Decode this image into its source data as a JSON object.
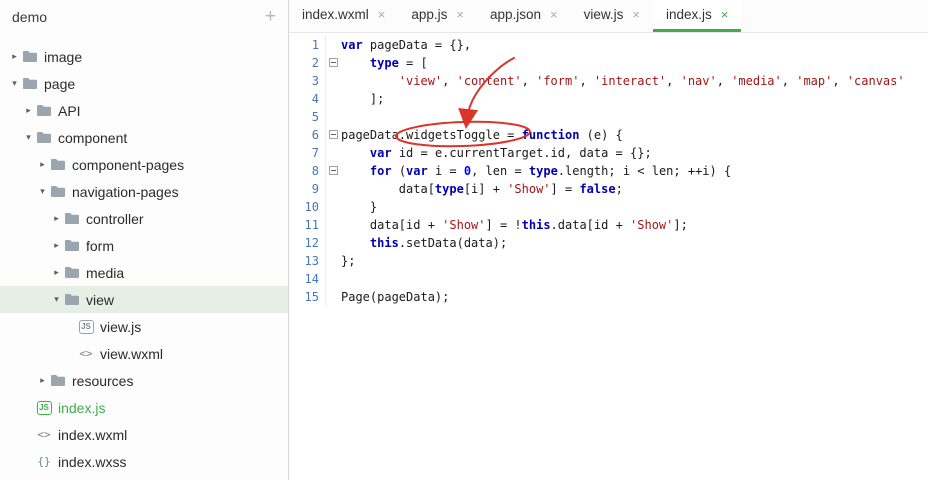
{
  "colors": {
    "accent_green": "#3fae4a",
    "tree_selection_bg": "#e5efe6",
    "annotation_red": "#d9352a",
    "syntax_keyword": "#0000b2",
    "syntax_string": "#a31515",
    "syntax_number": "#0000ff",
    "syntax_plain": "#1a1a1a",
    "line_number": "#4777b8"
  },
  "sidebar": {
    "title": "demo",
    "add_button": "+",
    "file_icons": {
      "js": "JS",
      "wxml": "<>",
      "wxss": "{}"
    },
    "tree": [
      {
        "label": "image",
        "depth": 0,
        "kind": "folder",
        "state": "collapsed"
      },
      {
        "label": "page",
        "depth": 0,
        "kind": "folder",
        "state": "expanded"
      },
      {
        "label": "API",
        "depth": 1,
        "kind": "folder",
        "state": "collapsed"
      },
      {
        "label": "component",
        "depth": 1,
        "kind": "folder",
        "state": "expanded"
      },
      {
        "label": "component-pages",
        "depth": 2,
        "kind": "folder",
        "state": "collapsed"
      },
      {
        "label": "navigation-pages",
        "depth": 2,
        "kind": "folder",
        "state": "expanded"
      },
      {
        "label": "controller",
        "depth": 3,
        "kind": "folder",
        "state": "collapsed"
      },
      {
        "label": "form",
        "depth": 3,
        "kind": "folder",
        "state": "collapsed"
      },
      {
        "label": "media",
        "depth": 3,
        "kind": "folder",
        "state": "collapsed"
      },
      {
        "label": "view",
        "depth": 3,
        "kind": "folder",
        "state": "expanded",
        "selected": true
      },
      {
        "label": "view.js",
        "depth": 4,
        "kind": "file",
        "icon": "js"
      },
      {
        "label": "view.wxml",
        "depth": 4,
        "kind": "file",
        "icon": "wxml"
      },
      {
        "label": "resources",
        "depth": 2,
        "kind": "folder",
        "state": "collapsed"
      },
      {
        "label": "index.js",
        "depth": 1,
        "kind": "file",
        "icon": "js",
        "highlight": true
      },
      {
        "label": "index.wxml",
        "depth": 1,
        "kind": "file",
        "icon": "wxml"
      },
      {
        "label": "index.wxss",
        "depth": 1,
        "kind": "file",
        "icon": "wxss"
      }
    ]
  },
  "tabs": [
    {
      "label": "index.wxml",
      "close": "×"
    },
    {
      "label": "app.js",
      "close": "×"
    },
    {
      "label": "app.json",
      "close": "×"
    },
    {
      "label": "view.js",
      "close": "×"
    },
    {
      "label": "index.js",
      "close": "×",
      "active": true
    }
  ],
  "editor": {
    "lines": [
      {
        "n": "1",
        "fold": false,
        "seg": [
          [
            "kw",
            "var"
          ],
          [
            "pl",
            " pageData = {},"
          ]
        ]
      },
      {
        "n": "2",
        "fold": true,
        "seg": [
          [
            "pl",
            "    "
          ],
          [
            "kw",
            "type"
          ],
          [
            "pl",
            " = ["
          ]
        ]
      },
      {
        "n": "3",
        "fold": false,
        "seg": [
          [
            "pl",
            "        "
          ],
          [
            "str",
            "'view'"
          ],
          [
            "pl",
            ", "
          ],
          [
            "str",
            "'content'"
          ],
          [
            "pl",
            ", "
          ],
          [
            "str",
            "'form'"
          ],
          [
            "pl",
            ", "
          ],
          [
            "str",
            "'interact'"
          ],
          [
            "pl",
            ", "
          ],
          [
            "str",
            "'nav'"
          ],
          [
            "pl",
            ", "
          ],
          [
            "str",
            "'media'"
          ],
          [
            "pl",
            ", "
          ],
          [
            "str",
            "'map'"
          ],
          [
            "pl",
            ", "
          ],
          [
            "str",
            "'canvas'"
          ]
        ]
      },
      {
        "n": "4",
        "fold": false,
        "seg": [
          [
            "pl",
            "    ];"
          ]
        ]
      },
      {
        "n": "5",
        "fold": false,
        "seg": []
      },
      {
        "n": "6",
        "fold": true,
        "seg": [
          [
            "pl",
            "pageData.widgetsToggle = "
          ],
          [
            "kw",
            "function"
          ],
          [
            "pl",
            " (e) {"
          ]
        ]
      },
      {
        "n": "7",
        "fold": false,
        "seg": [
          [
            "pl",
            "    "
          ],
          [
            "kw",
            "var"
          ],
          [
            "pl",
            " id = e.currentTarget.id, data = {};"
          ]
        ]
      },
      {
        "n": "8",
        "fold": true,
        "seg": [
          [
            "pl",
            "    "
          ],
          [
            "kw",
            "for"
          ],
          [
            "pl",
            " ("
          ],
          [
            "kw",
            "var"
          ],
          [
            "pl",
            " i = "
          ],
          [
            "num",
            "0"
          ],
          [
            "pl",
            ", len = "
          ],
          [
            "kw",
            "type"
          ],
          [
            "pl",
            ".length; i < len; ++i) {"
          ]
        ]
      },
      {
        "n": "9",
        "fold": false,
        "seg": [
          [
            "pl",
            "        data["
          ],
          [
            "kw",
            "type"
          ],
          [
            "pl",
            "[i] + "
          ],
          [
            "str",
            "'Show'"
          ],
          [
            "pl",
            "] = "
          ],
          [
            "kw",
            "false"
          ],
          [
            "pl",
            ";"
          ]
        ]
      },
      {
        "n": "10",
        "fold": false,
        "seg": [
          [
            "pl",
            "    }"
          ]
        ]
      },
      {
        "n": "11",
        "fold": false,
        "seg": [
          [
            "pl",
            "    data[id + "
          ],
          [
            "str",
            "'Show'"
          ],
          [
            "pl",
            "] = !"
          ],
          [
            "kw",
            "this"
          ],
          [
            "pl",
            ".data[id + "
          ],
          [
            "str",
            "'Show'"
          ],
          [
            "pl",
            "];"
          ]
        ]
      },
      {
        "n": "12",
        "fold": false,
        "seg": [
          [
            "pl",
            "    "
          ],
          [
            "kw",
            "this"
          ],
          [
            "pl",
            ".setData(data);"
          ]
        ]
      },
      {
        "n": "13",
        "fold": false,
        "seg": [
          [
            "pl",
            "};"
          ]
        ]
      },
      {
        "n": "14",
        "fold": false,
        "seg": []
      },
      {
        "n": "15",
        "fold": false,
        "seg": [
          [
            "pl",
            "Page(pageData);"
          ]
        ]
      }
    ]
  },
  "annotation": {
    "description": "hand-drawn red ellipse around pageData.widgetsToggle with arrow pointing from line 3"
  }
}
